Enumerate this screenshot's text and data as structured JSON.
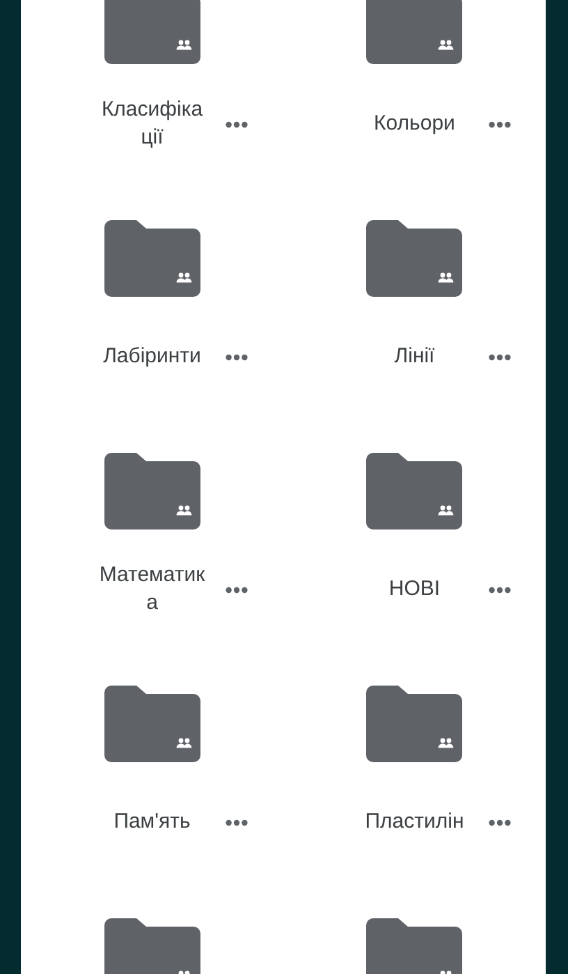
{
  "folders": [
    {
      "label": "Класифікації",
      "shared": true
    },
    {
      "label": "Кольори",
      "shared": true
    },
    {
      "label": "Лабіринти",
      "shared": true
    },
    {
      "label": "Лінії",
      "shared": true
    },
    {
      "label": "Математика",
      "shared": true
    },
    {
      "label": "НОВІ",
      "shared": true
    },
    {
      "label": "Пам'ять",
      "shared": true
    },
    {
      "label": "Пластилін",
      "shared": true
    },
    {
      "shared": true
    },
    {
      "shared": true
    }
  ]
}
